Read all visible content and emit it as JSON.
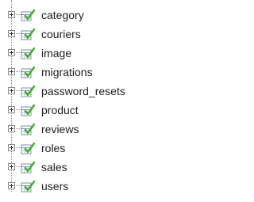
{
  "navigation_tree": {
    "expand_icon": "plus-box-icon",
    "table_icon": "table-with-checkmark-icon",
    "colors": {
      "text": "#1e1e1e",
      "lines": "#8a8a8a",
      "icon_green": "#3fae2a"
    },
    "tables": [
      {
        "name": "category"
      },
      {
        "name": "couriers"
      },
      {
        "name": "image"
      },
      {
        "name": "migrations"
      },
      {
        "name": "password_resets"
      },
      {
        "name": "product"
      },
      {
        "name": "reviews"
      },
      {
        "name": "roles"
      },
      {
        "name": "sales"
      },
      {
        "name": "users"
      }
    ]
  }
}
